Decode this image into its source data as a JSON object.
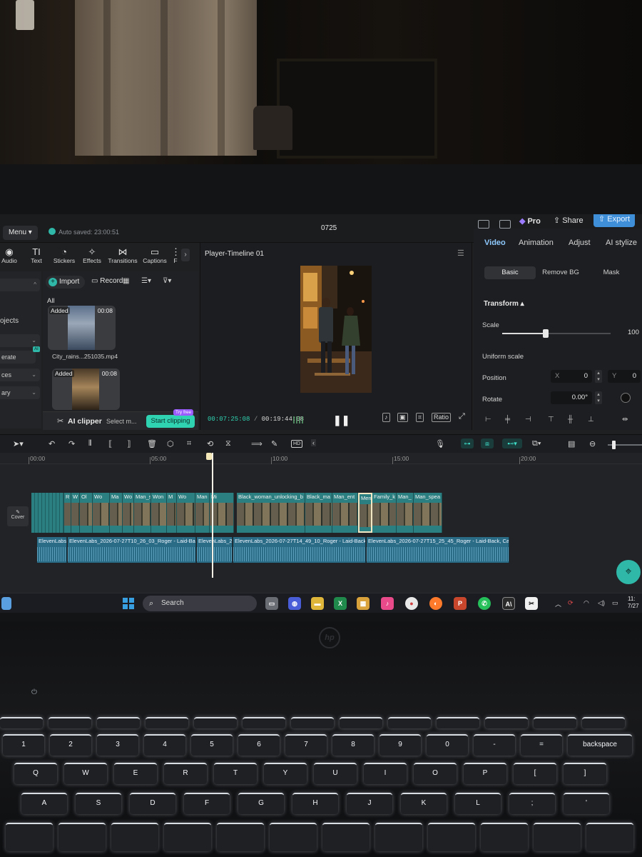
{
  "app": {
    "menu_label": "Menu",
    "autosave": "Auto saved: 23:00:51",
    "project_title": "0725",
    "pro_label": "Pro",
    "share_label": "Share",
    "export_label": "Export"
  },
  "toolbar": {
    "items": [
      {
        "label": "Audio",
        "icon": "audio-icon"
      },
      {
        "label": "Text",
        "icon": "text-icon"
      },
      {
        "label": "Stickers",
        "icon": "stickers-icon"
      },
      {
        "label": "Effects",
        "icon": "effects-icon"
      },
      {
        "label": "Transitions",
        "icon": "transitions-icon"
      },
      {
        "label": "Captions",
        "icon": "captions-icon"
      },
      {
        "label": "F",
        "icon": "filters-icon"
      }
    ]
  },
  "sidebar": {
    "items": [
      "",
      "ojects",
      "",
      "erate",
      "ces",
      "ary"
    ],
    "projects_label": "ojects"
  },
  "media": {
    "import_label": "Import",
    "record_label": "Record",
    "all_label": "All",
    "items": [
      {
        "status": "Added",
        "duration": "00:08",
        "name": "City_rains...251035.mp4"
      },
      {
        "status": "Added",
        "duration": "00:08",
        "name": ""
      }
    ],
    "ai_clipper_label": "AI clipper",
    "select_label": "Select m...",
    "start_clipping_label": "Start clipping",
    "try_free_label": "Try free"
  },
  "player": {
    "title": "Player-Timeline 01",
    "current_time": "00:07:25:08",
    "separator": "/",
    "total_time": "00:19:44:08",
    "ratio_label": "Ratio"
  },
  "inspector": {
    "tabs": [
      "Video",
      "Animation",
      "Adjust",
      "AI stylize"
    ],
    "active_tab": "Video",
    "sub_tabs": [
      "Basic",
      "Remove BG",
      "Mask"
    ],
    "active_sub_tab": "Basic",
    "section": "Transform",
    "scale_label": "Scale",
    "scale_value": "100",
    "scale_level_percent": 40,
    "uniform_scale_label": "Uniform scale",
    "position_label": "Position",
    "position_x_axis": "X",
    "position_x": "0",
    "position_y_axis": "Y",
    "position_y": "0",
    "rotate_label": "Rotate",
    "rotate_value": "0.00°"
  },
  "timeline": {
    "ruler": [
      "00:00",
      "05:00",
      "10:00",
      "15:00",
      "20:00"
    ],
    "cover_label": "Cover",
    "video_clips": [
      "R",
      "W",
      "Ol",
      "Wo",
      "Ma",
      "Wo",
      "Man_s",
      "Won",
      "M",
      "Wo",
      "Man",
      "Mi",
      "Black_woman_unlocking_b",
      "Black_ma",
      "Man_ent",
      "Men",
      "Family_k",
      "Man_",
      "Man_spea"
    ],
    "audio_clips": [
      "ElevenLabs_",
      "ElevenLabs_2026-07-27T10_26_03_Roger - Laid-Back",
      "ElevenLabs_2",
      "ElevenLabs_2026-07-27T14_49_10_Roger - Laid-Back,",
      "ElevenLabs_2026-07-27T15_25_45_Roger - Laid-Back, Ca"
    ]
  },
  "taskbar": {
    "search_placeholder": "Search",
    "clock_time": "11:",
    "clock_date": "7/27"
  },
  "laptop": {
    "brand": "hp"
  },
  "keyboard": {
    "row1": [
      "1",
      "2",
      "3",
      "4",
      "5",
      "6",
      "7",
      "8",
      "9",
      "0",
      "-",
      "=",
      "backspace"
    ],
    "row2": [
      "Q",
      "W",
      "E",
      "R",
      "T",
      "Y",
      "U",
      "I",
      "O",
      "P",
      "[",
      "]"
    ],
    "row3": [
      "A",
      "S",
      "D",
      "F",
      "G",
      "H",
      "J",
      "K",
      "L",
      ";",
      "'"
    ]
  },
  "colors": {
    "accent_teal": "#2fd3b2",
    "export_blue": "#3e8ed8",
    "video_clip": "#2c7f81",
    "audio_clip": "#2a6b86",
    "active_tab": "#8ec9ff"
  }
}
